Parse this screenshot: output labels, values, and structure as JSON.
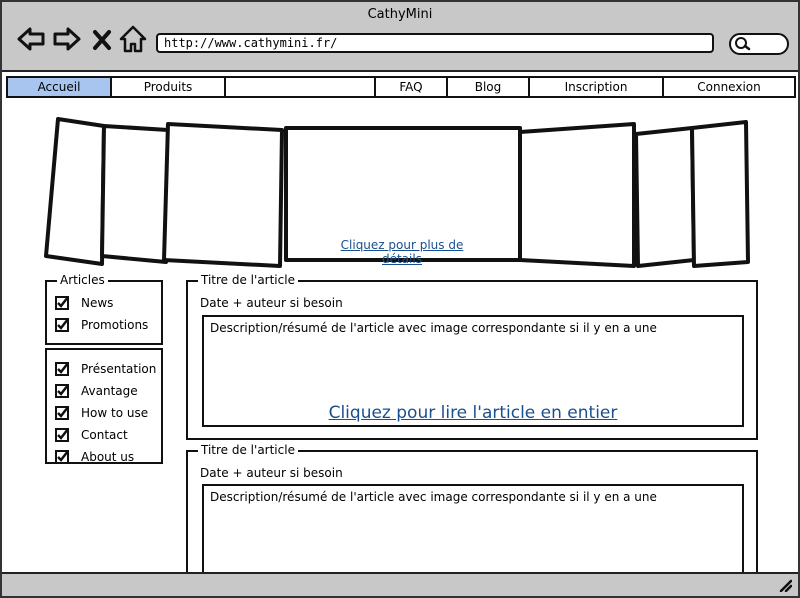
{
  "window": {
    "title": "CathyMini"
  },
  "toolbar": {
    "back_icon": "arrow-left-icon",
    "forward_icon": "arrow-right-icon",
    "close_icon": "close-icon",
    "home_icon": "home-icon",
    "url": "http://www.cathymini.fr/",
    "search_icon": "search-icon"
  },
  "menu": {
    "items": [
      "Accueil",
      "Produits",
      "",
      "FAQ",
      "Blog",
      "Inscription",
      "Connexion"
    ],
    "active": "Accueil"
  },
  "carousel": {
    "link": "Cliquez pour plus de détails"
  },
  "sidebar": {
    "group1_title": "Articles",
    "group1_items": [
      "News",
      "Promotions"
    ],
    "group2_items": [
      "Présentation",
      "Avantage",
      "How to use",
      "Contact",
      "About us"
    ]
  },
  "articles": [
    {
      "title": "Titre de l'article",
      "meta": "Date + auteur si besoin",
      "description": "Description/résumé de l'article avec image correspondante si il y en a une",
      "read_more": "Cliquez pour lire l'article en entier"
    },
    {
      "title": "Titre de l'article",
      "meta": "Date + auteur si besoin",
      "description": "Description/résumé de l'article avec image correspondante si il y en a une"
    }
  ],
  "colors": {
    "chrome": "#c8c8c8",
    "active_tab": "#a7c5ee",
    "link": "#1a4f8f"
  }
}
